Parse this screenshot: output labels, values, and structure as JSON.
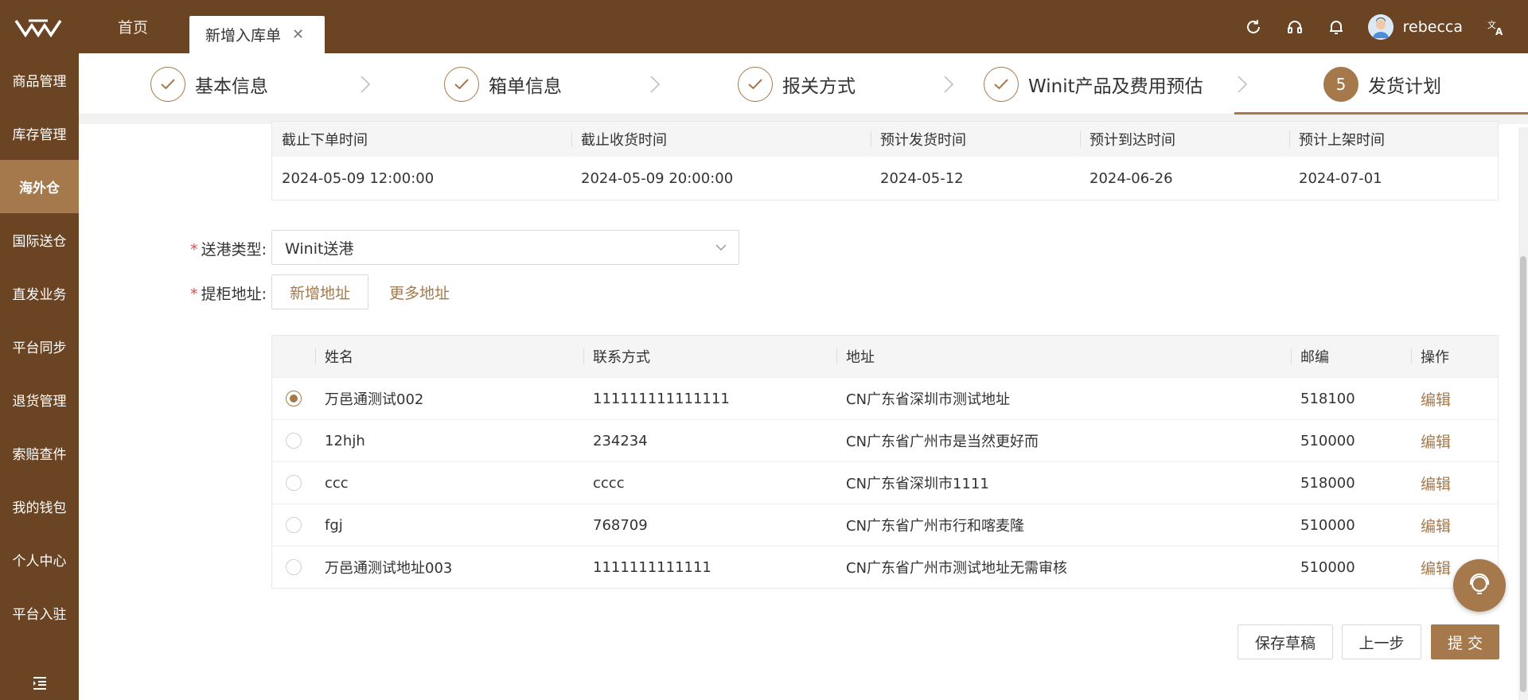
{
  "topbar": {
    "tabs": [
      {
        "label": "首页"
      },
      {
        "label": "新增入库单"
      }
    ],
    "username": "rebecca"
  },
  "sidebar": {
    "items": [
      {
        "label": "商品管理"
      },
      {
        "label": "库存管理"
      },
      {
        "label": "海外仓",
        "active": true
      },
      {
        "label": "国际送仓"
      },
      {
        "label": "直发业务"
      },
      {
        "label": "平台同步"
      },
      {
        "label": "退货管理"
      },
      {
        "label": "索赔查件"
      },
      {
        "label": "我的钱包"
      },
      {
        "label": "个人中心"
      },
      {
        "label": "平台入驻"
      }
    ]
  },
  "steps": [
    {
      "label": "基本信息",
      "status": "done"
    },
    {
      "label": "箱单信息",
      "status": "done"
    },
    {
      "label": "报关方式",
      "status": "done"
    },
    {
      "label": "Winit产品及费用预估",
      "status": "done"
    },
    {
      "label": "发货计划",
      "status": "current",
      "number": "5"
    }
  ],
  "schedule": {
    "headers": [
      "截止下单时间",
      "截止收货时间",
      "预计发货时间",
      "预计到达时间",
      "预计上架时间"
    ],
    "values": [
      "2024-05-09 12:00:00",
      "2024-05-09 20:00:00",
      "2024-05-12",
      "2024-06-26",
      "2024-07-01"
    ]
  },
  "form": {
    "port_type_label": "送港类型:",
    "port_type_value": "Winit送港",
    "pickup_label": "提柜地址:",
    "add_address": "新增地址",
    "more_address": "更多地址"
  },
  "address_table": {
    "headers": [
      "姓名",
      "联系方式",
      "地址",
      "邮编",
      "操作"
    ],
    "rows": [
      {
        "name": "万邑通测试002",
        "contact": "111111111111111",
        "address": "CN广东省深圳市测试地址",
        "zip": "518100",
        "action": "编辑",
        "selected": true
      },
      {
        "name": "12hjh",
        "contact": "234234",
        "address": "CN广东省广州市是当然更好而",
        "zip": "510000",
        "action": "编辑",
        "selected": false
      },
      {
        "name": "ccc",
        "contact": "cccc",
        "address": "CN广东省深圳市1111",
        "zip": "518000",
        "action": "编辑",
        "selected": false
      },
      {
        "name": "fgj",
        "contact": "768709",
        "address": "CN广东省广州市行和喀麦隆",
        "zip": "510000",
        "action": "编辑",
        "selected": false
      },
      {
        "name": "万邑通测试地址003",
        "contact": "1111111111111",
        "address": "CN广东省广州市测试地址无需审核",
        "zip": "510000",
        "action": "编辑",
        "selected": false
      }
    ]
  },
  "actions": {
    "save_draft": "保存草稿",
    "prev": "上一步",
    "submit": "提 交"
  },
  "colors": {
    "brand": "#6b4423",
    "accent": "#a5794b"
  }
}
